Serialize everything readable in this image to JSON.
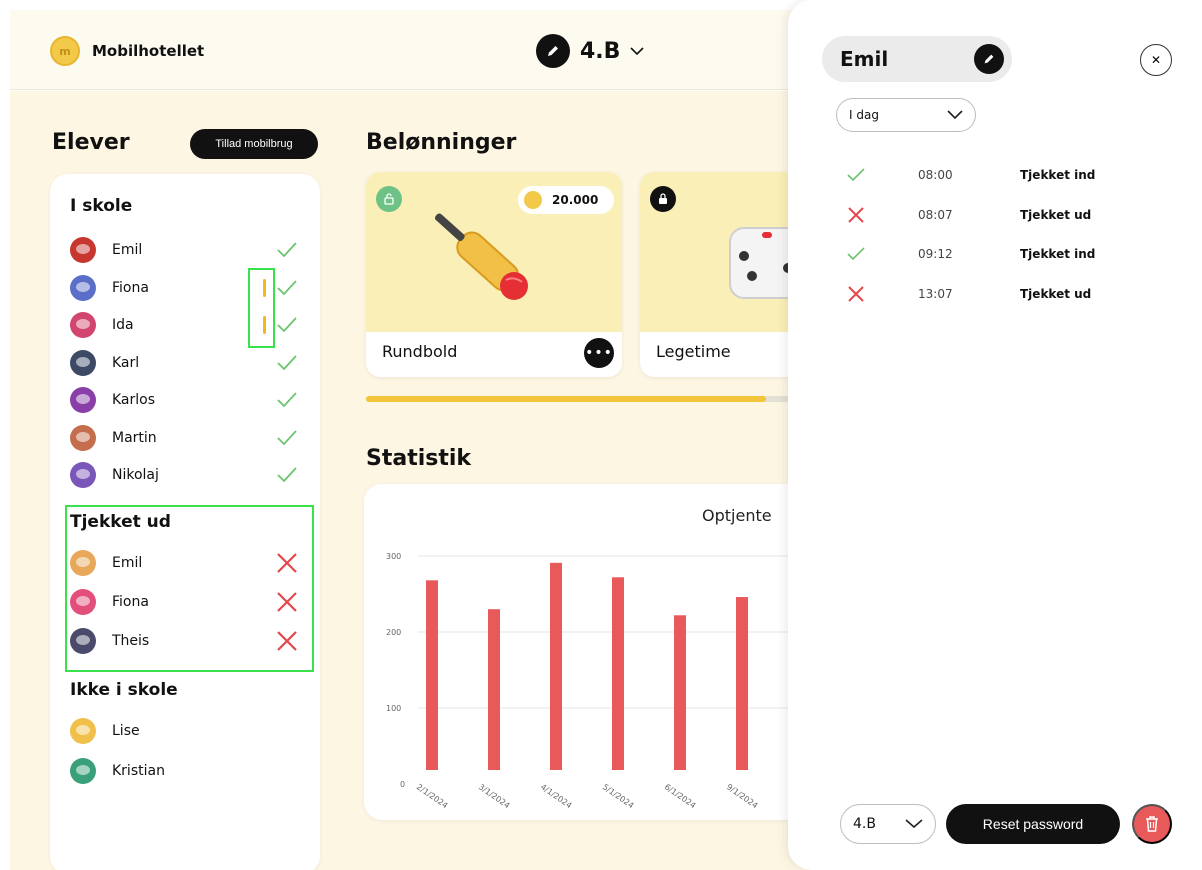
{
  "app": {
    "name": "Mobilhotellet"
  },
  "header": {
    "class_label": "4.B"
  },
  "students": {
    "title": "Elever",
    "allow_button": "Tillad mobilbrug",
    "in_school": {
      "title": "I skole",
      "items": [
        {
          "name": "Emil",
          "flag": false
        },
        {
          "name": "Fiona",
          "flag": true
        },
        {
          "name": "Ida",
          "flag": true
        },
        {
          "name": "Karl",
          "flag": false
        },
        {
          "name": "Karlos",
          "flag": false
        },
        {
          "name": "Martin",
          "flag": false
        },
        {
          "name": "Nikolaj",
          "flag": false
        }
      ]
    },
    "checked_out": {
      "title": "Tjekket ud",
      "items": [
        {
          "name": "Emil"
        },
        {
          "name": "Fiona"
        },
        {
          "name": "Theis"
        }
      ]
    },
    "not_in_school": {
      "title": "Ikke i skole",
      "items": [
        {
          "name": "Lise"
        },
        {
          "name": "Kristian"
        }
      ]
    }
  },
  "rewards": {
    "title": "Belønninger",
    "items": [
      {
        "label": "Rundbold",
        "price": "20.000"
      },
      {
        "label": "Legetime"
      }
    ],
    "progress": 0.93
  },
  "stats": {
    "title": "Statistik"
  },
  "chart_data": {
    "type": "bar",
    "title": "Optjente",
    "categories": [
      "2/1/2024",
      "3/1/2024",
      "4/1/2024",
      "5/1/2024",
      "6/1/2024",
      "9/1/2024"
    ],
    "values": [
      268,
      230,
      291,
      272,
      222,
      246
    ],
    "ylim": [
      0,
      300
    ],
    "yticks": [
      0,
      100,
      200,
      300
    ],
    "grid": true,
    "colors": {
      "bar": "#e85a5a"
    }
  },
  "panel": {
    "student_name": "Emil",
    "period": "I dag",
    "log": [
      {
        "time": "08:00",
        "text": "Tjekket ind",
        "status": "in"
      },
      {
        "time": "08:07",
        "text": "Tjekket ud",
        "status": "out"
      },
      {
        "time": "09:12",
        "text": "Tjekket ind",
        "status": "in"
      },
      {
        "time": "13:07",
        "text": "Tjekket ud",
        "status": "out"
      }
    ],
    "class_select": "4.B",
    "reset_button": "Reset password"
  },
  "colors": {
    "accent_yellow": "#f3c94a",
    "check_green": "#6cc46c",
    "cross_red": "#e4474c"
  }
}
